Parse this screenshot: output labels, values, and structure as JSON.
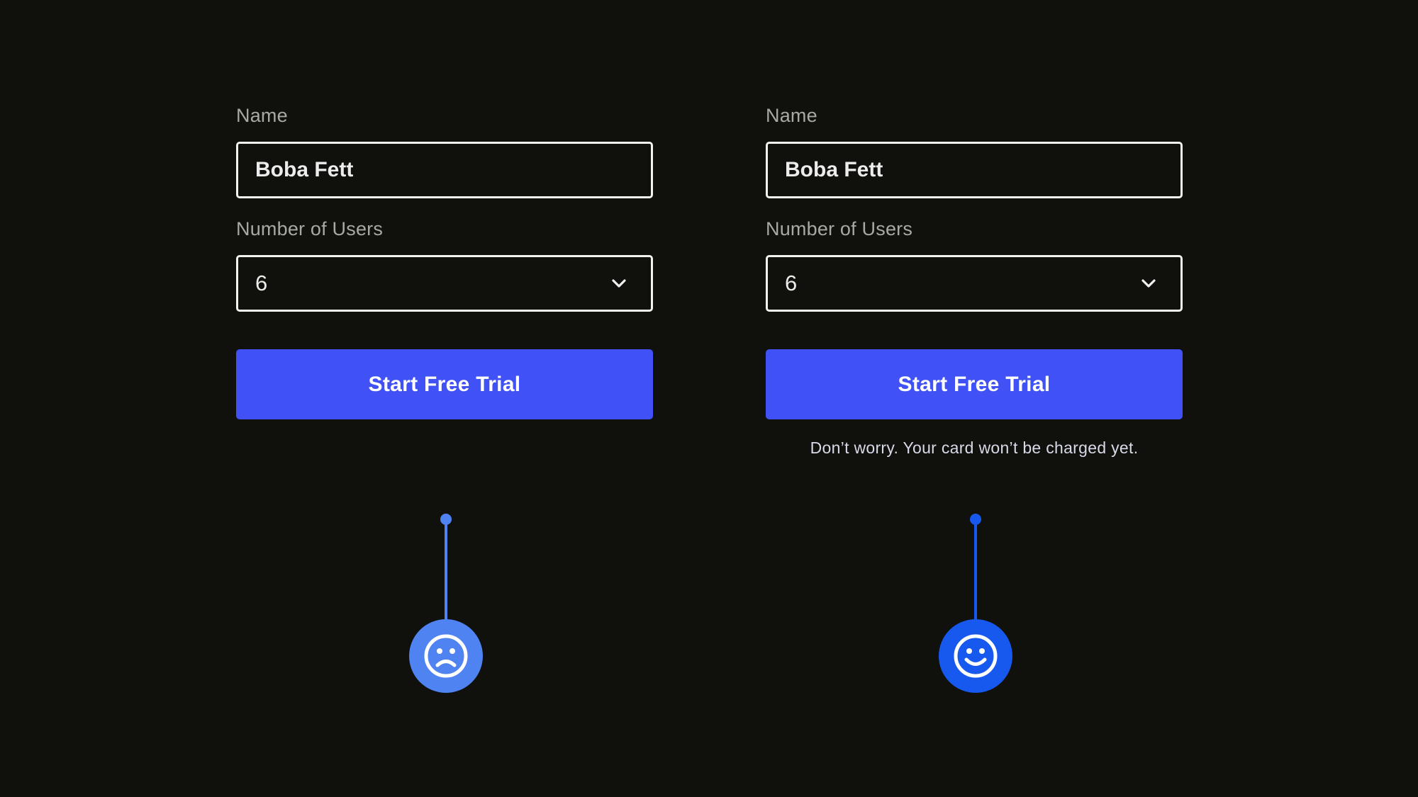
{
  "colors": {
    "background": "#10100c",
    "button": "#4052f5",
    "sad_marker": "#4f83f2",
    "happy_marker": "#1758ee"
  },
  "variant_a": {
    "name_label": "Name",
    "name_value": "Boba Fett",
    "users_label": "Number of Users",
    "users_value": "6",
    "button_label": "Start Free Trial",
    "marker_icon": "sad-face-icon"
  },
  "variant_b": {
    "name_label": "Name",
    "name_value": "Boba Fett",
    "users_label": "Number of Users",
    "users_value": "6",
    "button_label": "Start Free Trial",
    "note": "Don’t worry. Your card won’t be charged yet.",
    "marker_icon": "happy-face-icon"
  }
}
